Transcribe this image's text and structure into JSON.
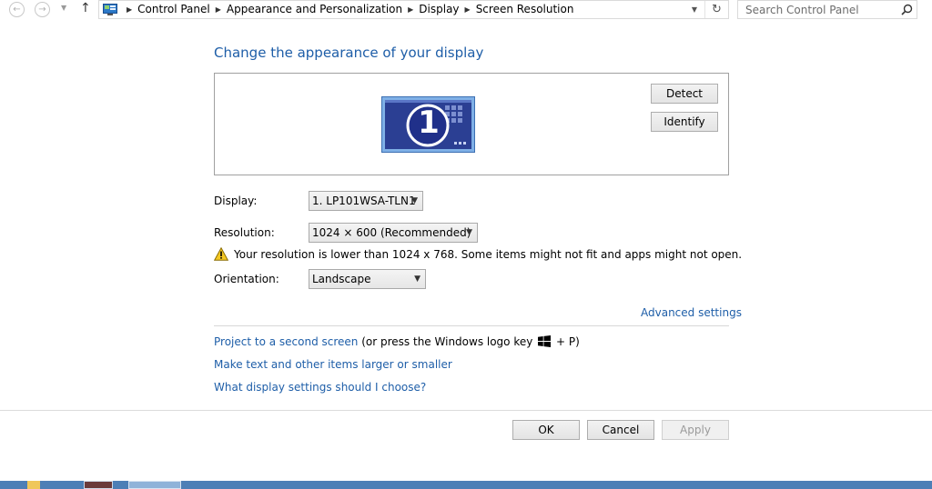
{
  "nav": {
    "breadcrumbs": [
      "Control Panel",
      "Appearance and Personalization",
      "Display",
      "Screen Resolution"
    ],
    "search_placeholder": "Search Control Panel"
  },
  "main": {
    "title": "Change the appearance of your display",
    "detect_label": "Detect",
    "identify_label": "Identify",
    "monitor_number": "1",
    "display_label": "Display:",
    "display_value": "1. LP101WSA-TLN1",
    "resolution_label": "Resolution:",
    "resolution_value": "1024 × 600 (Recommended)",
    "warning_text": "Your resolution is lower than 1024 x 768. Some items might not fit and apps might not open.",
    "orientation_label": "Orientation:",
    "orientation_value": "Landscape",
    "advanced_link": "Advanced settings",
    "project_link": "Project to a second screen",
    "project_hint_before": "(or press the Windows logo key",
    "project_hint_after": "+ P)",
    "larger_link": "Make text and other items larger or smaller",
    "which_link": "What display settings should I choose?"
  },
  "footer": {
    "ok_label": "OK",
    "cancel_label": "Cancel",
    "apply_label": "Apply"
  },
  "colors": {
    "link": "#1e5ea8",
    "taskbar": "#4d7fb6",
    "monitor_bg": "#2b3f93"
  }
}
